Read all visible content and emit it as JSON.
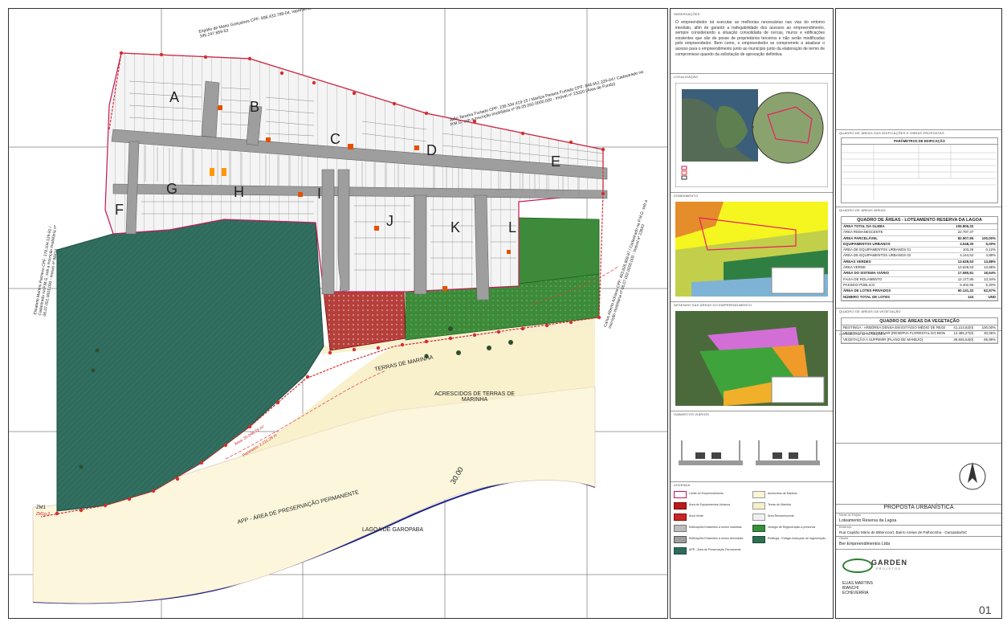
{
  "map": {
    "block_labels": [
      "A",
      "B",
      "C",
      "D",
      "E",
      "F",
      "G",
      "H",
      "I",
      "J",
      "K",
      "L"
    ],
    "terras_marinha": "TERRAS DE MARINHA",
    "acrescidos": "ACRESCIDOS DE TERRAS DE MARINHA",
    "app": "APP - ÁREA DE PRESERVAÇÃO PERMANENTE",
    "lagoa": "LAGOA DE GAROPABA",
    "contour": "30.00",
    "mark_zm1": "ZM1",
    "mark_zm2": "ZM1p-2",
    "marinha_area": "Área: 20.046,79 m²",
    "marinha_perimetro": "Perímetro: 2.211,29 m",
    "owner_top": "Espólio de Mario Gonçalves CPF: 696.433.789-04, representado por: Valmor Gonçalves CPF: 345.247.659-53",
    "owner_right": "João Teixeira Furtado CPF: 239.334.419-15 / Marilza Pereira Furtado CPF: 848.661.229-04 / Cadastrado na P.M.G. sob a inscrição imobiliária nº 06.05.092.0000.000 - Imóvel nº 23320 (Área de Fundo)",
    "owner_left": "Elisabete Martins Pacheco CPF: 178.104.129-91 / Cadastrado na P.M.G. sob a inscrição imobiliária nº 06.07.001.0001.000 - Imóvel nº 98434",
    "owner_far_right": "Carlos Alberto Adriano CPF: 463.826.909-97 / Cadastrado na P.M.G. sob a inscrição imobiliária nº 06.07.002.0000.000 - Imóvel nº 23643"
  },
  "side": {
    "observacoes_title": "OBSERVAÇÕES",
    "observacoes_text": "O empreendedor irá executar as melhorias necessárias nas vias do entorno imediato, afim de garantir a trafegabilidade dos acessos ao empreendimento, sempre considerando a situação consolidada de cercas, muros e edificações existentes que são de posse de proprietários terceiros e não serão modificadas pelo empreendedor. Bem como, o empreendedor se compromete a atualizar o acesso para o empreendimento junto ao município junto da elaboração de termo de compromisso quando da solicitação de aprovação definitiva.",
    "localizacao_title": "LOCALIZAÇÃO",
    "zoneamento_title": "ZONEAMENTO",
    "desenho_title": "DESENHO DAS ÁREAS DO EMPREENDIMENTO",
    "gabaritos_title": "GABARITOS VIÁRIOS",
    "legenda_title": "LEGENDA",
    "legend": [
      {
        "label": "Limite do Empreendimento",
        "color": "#ffffff",
        "border": "#c2185b"
      },
      {
        "label": "Área de Equipamentos Urbanos",
        "color": "#b71c1c",
        "border": "#7f0000"
      },
      {
        "label": "Área Verde",
        "color": "#c62828",
        "border": "#8e0000"
      },
      {
        "label": "Edificações Existentes a serem mantidas",
        "color": "#bdbdbd",
        "border": "#777777"
      },
      {
        "label": "Edificações Existentes a serem demolidas",
        "color": "#9e9e9e",
        "border": "#555555"
      },
      {
        "label": "APP - Área de Preservação Permanente",
        "color": "#2e6b5a",
        "border": "#1b4a3d"
      },
      {
        "label": "Acrescidos de Marinha",
        "color": "#fbf4d5",
        "border": "#999999"
      },
      {
        "label": "Terras de Marinha",
        "color": "#f7efc8",
        "border": "#999999"
      },
      {
        "label": "Área Remanescente",
        "color": "#f0f0f0",
        "border": "#999999"
      },
      {
        "label": "Vestígio de Regeneração a preservar",
        "color": "#388e3c",
        "border": "#1b5e20"
      },
      {
        "label": "Restinga - Estágio avançado de regeneração",
        "color": "#2f6f4f",
        "border": "#1b4a3d"
      }
    ]
  },
  "quadro": {
    "parametros_title": "QUADRO DE ÁREAS DAS EDIFICAÇÕES E OBRAS PROPOSTAS",
    "parametros_header": "PARÂMETROS DE EDIFICAÇÃO",
    "quadro_areas_section": "QUADRO DE ÁREAS ÁREAS",
    "areas_title": "QUADRO DE ÁREAS - LOTEAMENTO RESERVA DA LAGOA",
    "rows": [
      {
        "label": "ÁREA TOTAL DA GLEBA",
        "m2": "105.806,32",
        "pct": "",
        "bold": true
      },
      {
        "label": "ÁREA REMANESCENTE",
        "m2": "22.797,37",
        "pct": "",
        "bold": false
      },
      {
        "label": "ÁREA PARCELÁVEL",
        "m2": "82.907,95",
        "pct": "100,00%",
        "bold": true
      },
      {
        "label": "EQUIPAMENTOS URBANOS",
        "m2": "4.548,30",
        "pct": "5,00%",
        "bold": true
      },
      {
        "label": "ÁREA DE EQUIPAMENTOS URBANOS 01",
        "m2": "103,26",
        "pct": "0,12%",
        "bold": false
      },
      {
        "label": "ÁREA DE EQUIPAMENTOS URBANOS 02",
        "m2": "4.144,52",
        "pct": "4,88%",
        "bold": false
      },
      {
        "label": "ÁREAS VERDES",
        "m2": "13.628,53",
        "pct": "13,88%",
        "bold": true
      },
      {
        "label": "ÁREA VERDE",
        "m2": "13.628,53",
        "pct": "13,88%",
        "bold": false
      },
      {
        "label": "ÁREA DO SISTEMA VIÁRIO",
        "m2": "17.580,81",
        "pct": "18,54%",
        "bold": true
      },
      {
        "label": "FAIXA DE ROLAMENTO",
        "m2": "12.177,85",
        "pct": "13,34%",
        "bold": false
      },
      {
        "label": "PASSEIO PÚBLICO",
        "m2": "5.402,96",
        "pct": "5,20%",
        "bold": false
      },
      {
        "label": "ÁREA DE LOTES PRIVADOS",
        "m2": "50.131,32",
        "pct": "62,57%",
        "bold": true
      },
      {
        "label": "NÚMERO TOTAL DE LOTES",
        "m2": "144",
        "pct": "UND",
        "bold": true
      }
    ],
    "veg_section": "QUADRO DE ÁREAS DA VEGETAÇÃO",
    "veg_title": "QUADRO DE ÁREAS DA VEGETAÇÃO",
    "veg_rows": [
      {
        "label": "RESTINGA - ARBÓREA DENSA EM ESTÁGIO MÉDIO DE REGENERAÇÃO",
        "m2": "41.214,82(0)",
        "pct": "100,00%"
      },
      {
        "label": "VEGETAÇÃO A PRESERVAR (RESERVA FLORESTAL DO BIOMA)",
        "m2": "12.385,27(0)",
        "pct": "30,05%"
      },
      {
        "label": "VEGETAÇÃO A SUPRIMIR (PLANO DE MANEJO)",
        "m2": "28.845,64(0)",
        "pct": "69,99%"
      }
    ],
    "carimbos_title": "CARIMBOS E APROVAÇÕES"
  },
  "titleblock": {
    "etapa": "PROPOSTA URBANÍSTICA",
    "projeto_label": "Nome do Projeto",
    "projeto": "Loteamento Reserva da Lagoa",
    "endereco_label": "Endereço",
    "endereco": "Rua Capitão Mário de Bittencourt, Bairro Areias de Palhocinha - Garopaba/SC",
    "cliente_label": "Cliente",
    "cliente": "Ber Empreendimentos Ltda",
    "empresa": "GARDEN",
    "empresa_sub": "PROJETOS",
    "folha": "01",
    "responsaveis": "ELIAS MARTINS BIANCHI ECHEVERRIA"
  }
}
